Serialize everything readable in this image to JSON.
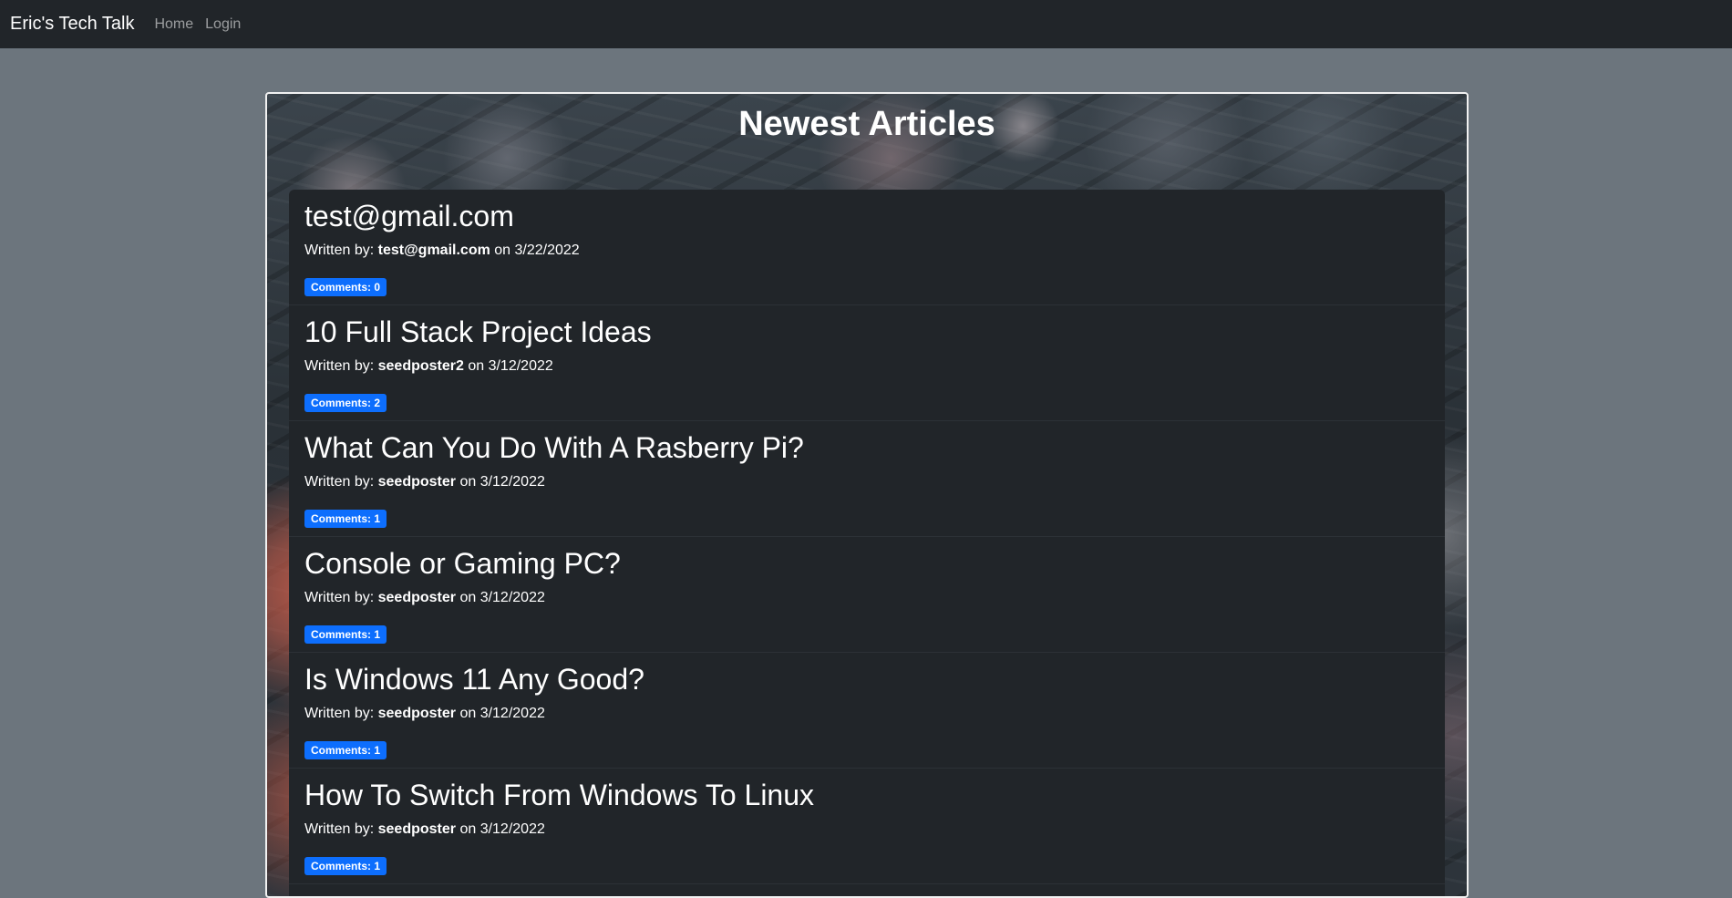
{
  "navbar": {
    "brand": "Eric's Tech Talk",
    "links": [
      "Home",
      "Login"
    ]
  },
  "main": {
    "heading": "Newest Articles",
    "articles": [
      {
        "title": "test@gmail.com",
        "written_by_label": "Written by: ",
        "author": "test@gmail.com",
        "on_label": " on ",
        "date": "3/22/2022",
        "comments": "Comments: 0"
      },
      {
        "title": "10 Full Stack Project Ideas",
        "written_by_label": "Written by: ",
        "author": "seedposter2",
        "on_label": " on ",
        "date": "3/12/2022",
        "comments": "Comments: 2"
      },
      {
        "title": "What Can You Do With A Rasberry Pi?",
        "written_by_label": "Written by: ",
        "author": "seedposter",
        "on_label": " on ",
        "date": "3/12/2022",
        "comments": "Comments: 1"
      },
      {
        "title": "Console or Gaming PC?",
        "written_by_label": "Written by: ",
        "author": "seedposter",
        "on_label": " on ",
        "date": "3/12/2022",
        "comments": "Comments: 1"
      },
      {
        "title": "Is Windows 11 Any Good?",
        "written_by_label": "Written by: ",
        "author": "seedposter",
        "on_label": " on ",
        "date": "3/12/2022",
        "comments": "Comments: 1"
      },
      {
        "title": "How To Switch From Windows To Linux",
        "written_by_label": "Written by: ",
        "author": "seedposter",
        "on_label": " on ",
        "date": "3/12/2022",
        "comments": "Comments: 1"
      }
    ]
  },
  "colors": {
    "navbar_bg": "#212529",
    "page_bg": "#6c757d",
    "card_bg": "#212529",
    "badge_bg": "#0d6efd"
  }
}
